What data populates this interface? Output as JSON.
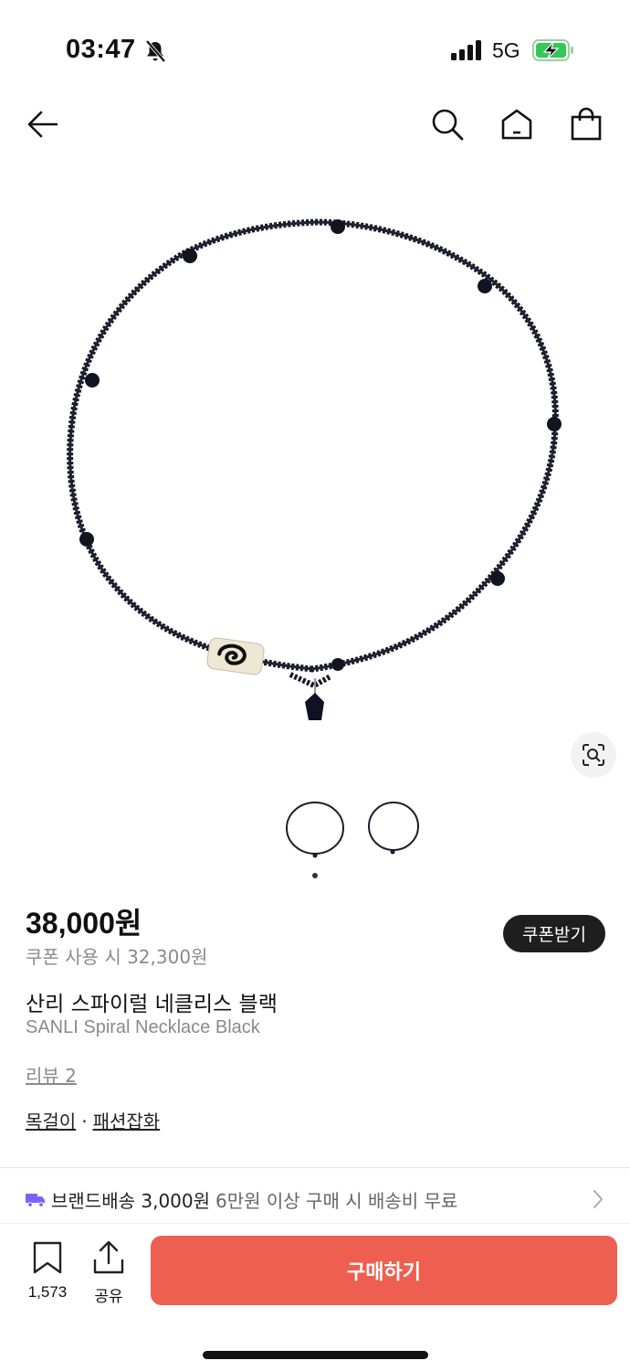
{
  "status": {
    "time": "03:47",
    "network": "5G"
  },
  "nav": {
    "icons": [
      "back-arrow-icon",
      "search-icon",
      "home-icon",
      "shopping-bag-icon"
    ]
  },
  "product": {
    "price": "38,000원",
    "coupon_price": "쿠폰 사용 시 32,300원",
    "coupon_button": "쿠폰받기",
    "name_ko": "산리 스파이럴 네클리스 블랙",
    "name_en": "SANLI Spiral Necklace Black",
    "review": "리뷰 2",
    "category_1": "목걸이",
    "category_sep": "·",
    "category_2": "패션잡화"
  },
  "shipping": {
    "label": "브랜드배송 3,000원",
    "note": "6만원 이상 구매 시 배송비 무료"
  },
  "bottom_bar": {
    "bookmark_count": "1,573",
    "share_label": "공유",
    "buy_label": "구매하기"
  },
  "colors": {
    "buy_button": "#ee5f50",
    "coupon_button": "#1e1e1e",
    "shipping_icon": "#7b61ff"
  }
}
